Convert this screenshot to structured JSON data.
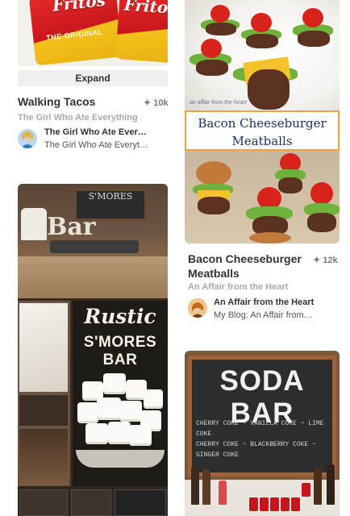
{
  "pins": {
    "walking_tacos": {
      "image_text": {
        "bag1": "Fritos",
        "bag2": "Fritos",
        "bag_sub": "THE ORIGINAL"
      },
      "expand_label": "Expand",
      "title": "Walking Tacos",
      "saves": "10k",
      "source": "The Girl Who Ate Everything",
      "credit_name": "The Girl Who Ate Ever…",
      "credit_board": "The Girl Who Ate Everyt…"
    },
    "bacon_meatballs": {
      "image_title_line1": "Bacon Cheeseburger",
      "image_title_line2": "Meatballs",
      "watermark": "an affair from the heart",
      "title_line1": "Bacon Cheeseburger",
      "title_line2": "Meatballs",
      "saves": "12k",
      "source": "An Affair from the Heart",
      "credit_name": "An Affair from the Heart",
      "credit_board": "My Blog: An Affair from…"
    },
    "smores_bar": {
      "board_text": "S'MORES",
      "bar_word": "Bar",
      "title_script": "Rustic",
      "title_block": "S'MORES BAR"
    },
    "soda_bar": {
      "title": "SODA BAR",
      "menu_lines": [
        "CHERRY COKE  ~  VANILLA COKE  ~  LIME COKE",
        "CHERRY COKE  ~  BLACKBERRY COKE  ~  GINGER COKE"
      ]
    }
  },
  "icons": {
    "saves": "pin-icon"
  },
  "colors": {
    "accent_orange": "#f2a23a",
    "title_navy": "#1f2f6f",
    "text": "#333333",
    "muted": "#aaaaaa"
  }
}
